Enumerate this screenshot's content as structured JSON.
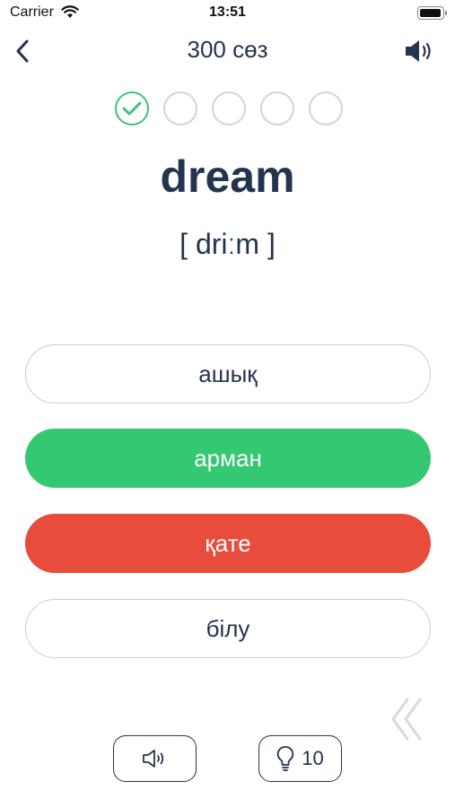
{
  "status_bar": {
    "carrier": "Carrier",
    "time": "13:51",
    "battery_level": 1.0
  },
  "nav": {
    "title": "300 сөз",
    "back_icon": "chevron-left-icon",
    "sound_icon": "speaker-icon"
  },
  "progress": {
    "completed": 1,
    "total": 5
  },
  "word": {
    "text": "dream",
    "transcription": "[ driːm ]"
  },
  "answers": [
    {
      "label": "ашық",
      "state": "neutral"
    },
    {
      "label": "арман",
      "state": "correct"
    },
    {
      "label": "қате",
      "state": "wrong"
    },
    {
      "label": "білу",
      "state": "neutral"
    }
  ],
  "bottom": {
    "hint_count": "10"
  },
  "colors": {
    "primary": "#24344f",
    "correct": "#34c872",
    "wrong": "#e84c3d",
    "dot_border": "#cfd3e6",
    "dot_done": "#3ec476"
  }
}
